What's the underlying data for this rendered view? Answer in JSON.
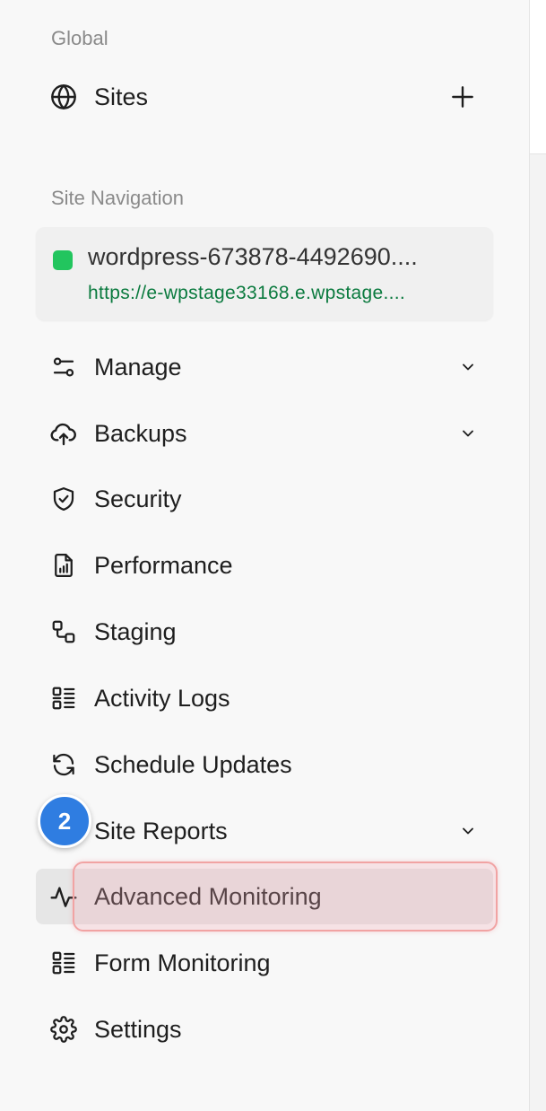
{
  "sections": {
    "global_label": "Global",
    "site_nav_label": "Site Navigation"
  },
  "global": {
    "sites_label": "Sites"
  },
  "site_card": {
    "name": "wordpress-673878-4492690....",
    "url": "https://e-wpstage33168.e.wpstage....",
    "status_color": "#22c55e"
  },
  "nav": {
    "items": [
      {
        "label": "Manage",
        "icon": "sliders-icon",
        "expandable": true
      },
      {
        "label": "Backups",
        "icon": "cloud-upload-icon",
        "expandable": true
      },
      {
        "label": "Security",
        "icon": "shield-check-icon",
        "expandable": false
      },
      {
        "label": "Performance",
        "icon": "file-chart-icon",
        "expandable": false
      },
      {
        "label": "Staging",
        "icon": "staging-nodes-icon",
        "expandable": false
      },
      {
        "label": "Activity Logs",
        "icon": "list-grid-icon",
        "expandable": false
      },
      {
        "label": "Schedule Updates",
        "icon": "refresh-icon",
        "expandable": false
      },
      {
        "label": "Site Reports",
        "icon": "report-icon",
        "expandable": true
      },
      {
        "label": "Advanced Monitoring",
        "icon": "pulse-icon",
        "expandable": false,
        "active": true
      },
      {
        "label": "Form Monitoring",
        "icon": "list-grid-icon",
        "expandable": false
      },
      {
        "label": "Settings",
        "icon": "gear-icon",
        "expandable": false
      }
    ]
  },
  "overlay": {
    "step_number": "2",
    "highlight_color": "#f1a3a3",
    "badge_color": "#2f7de1"
  }
}
